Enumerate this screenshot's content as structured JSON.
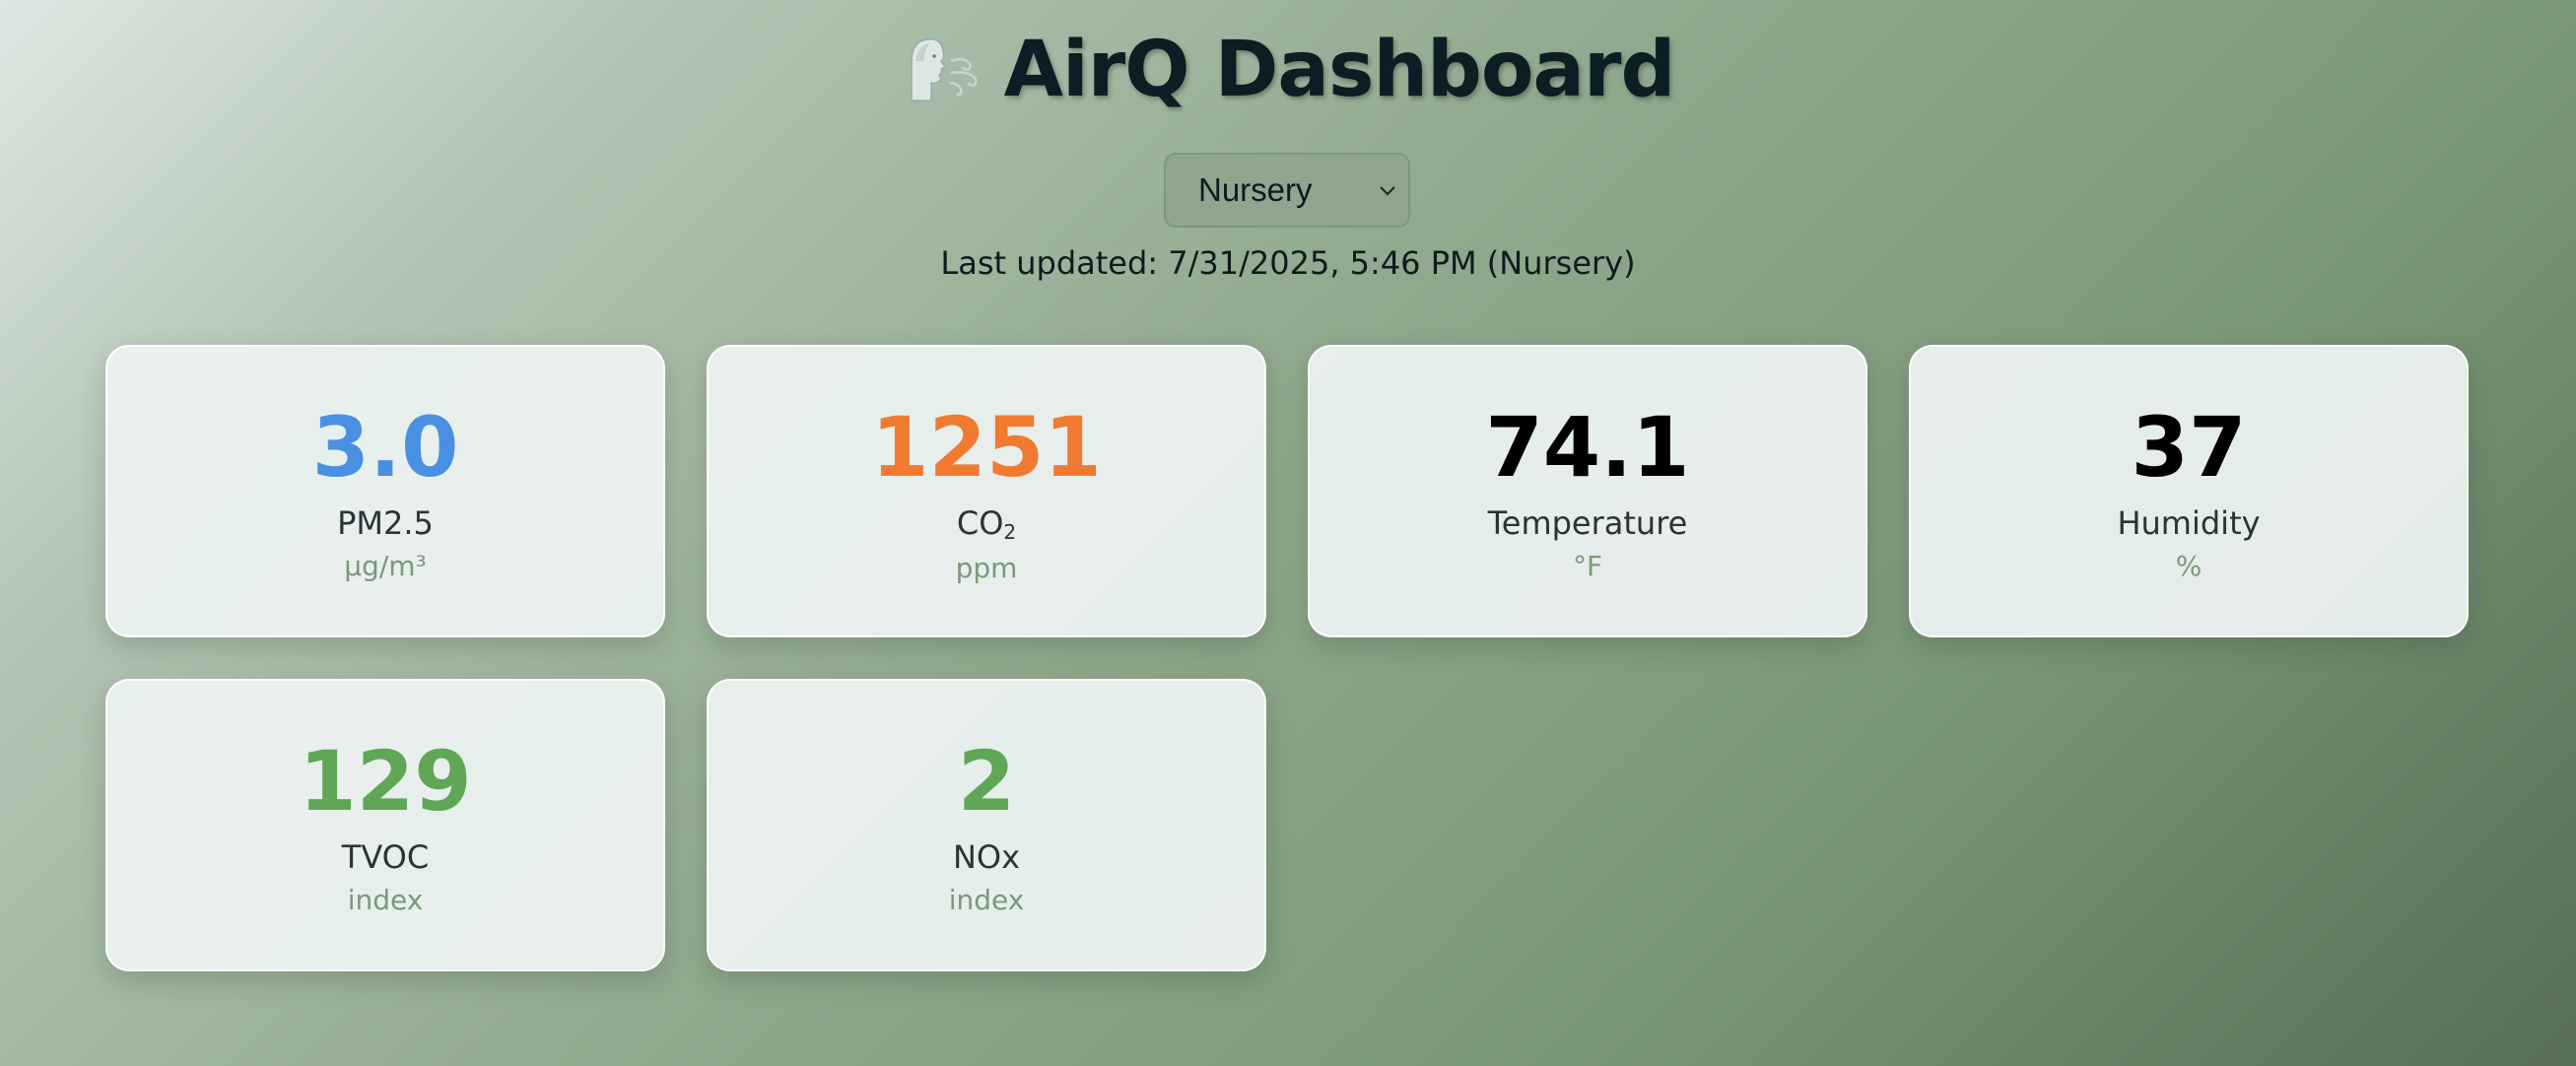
{
  "header": {
    "title": "AirQ Dashboard",
    "logo_icon": "wind-face-icon"
  },
  "location_select": {
    "selected": "Nursery",
    "chevron_icon": "chevron-down-icon"
  },
  "status": {
    "last_updated": "Last updated: 7/31/2025, 5:46 PM (Nursery)"
  },
  "metrics": [
    {
      "value": "3.0",
      "label": "PM2.5",
      "unit": "µg/m³",
      "color": "#4a90e2"
    },
    {
      "value": "1251",
      "label_main": "CO",
      "label_sub": "2",
      "unit": "ppm",
      "color": "#f07a30"
    },
    {
      "value": "74.1",
      "label": "Temperature",
      "unit": "°F",
      "color": "#000000"
    },
    {
      "value": "37",
      "label": "Humidity",
      "unit": "%",
      "color": "#000000"
    },
    {
      "value": "129",
      "label": "TVOC",
      "unit": "index",
      "color": "#5fa656"
    },
    {
      "value": "2",
      "label": "NOx",
      "unit": "index",
      "color": "#5fa656"
    }
  ]
}
